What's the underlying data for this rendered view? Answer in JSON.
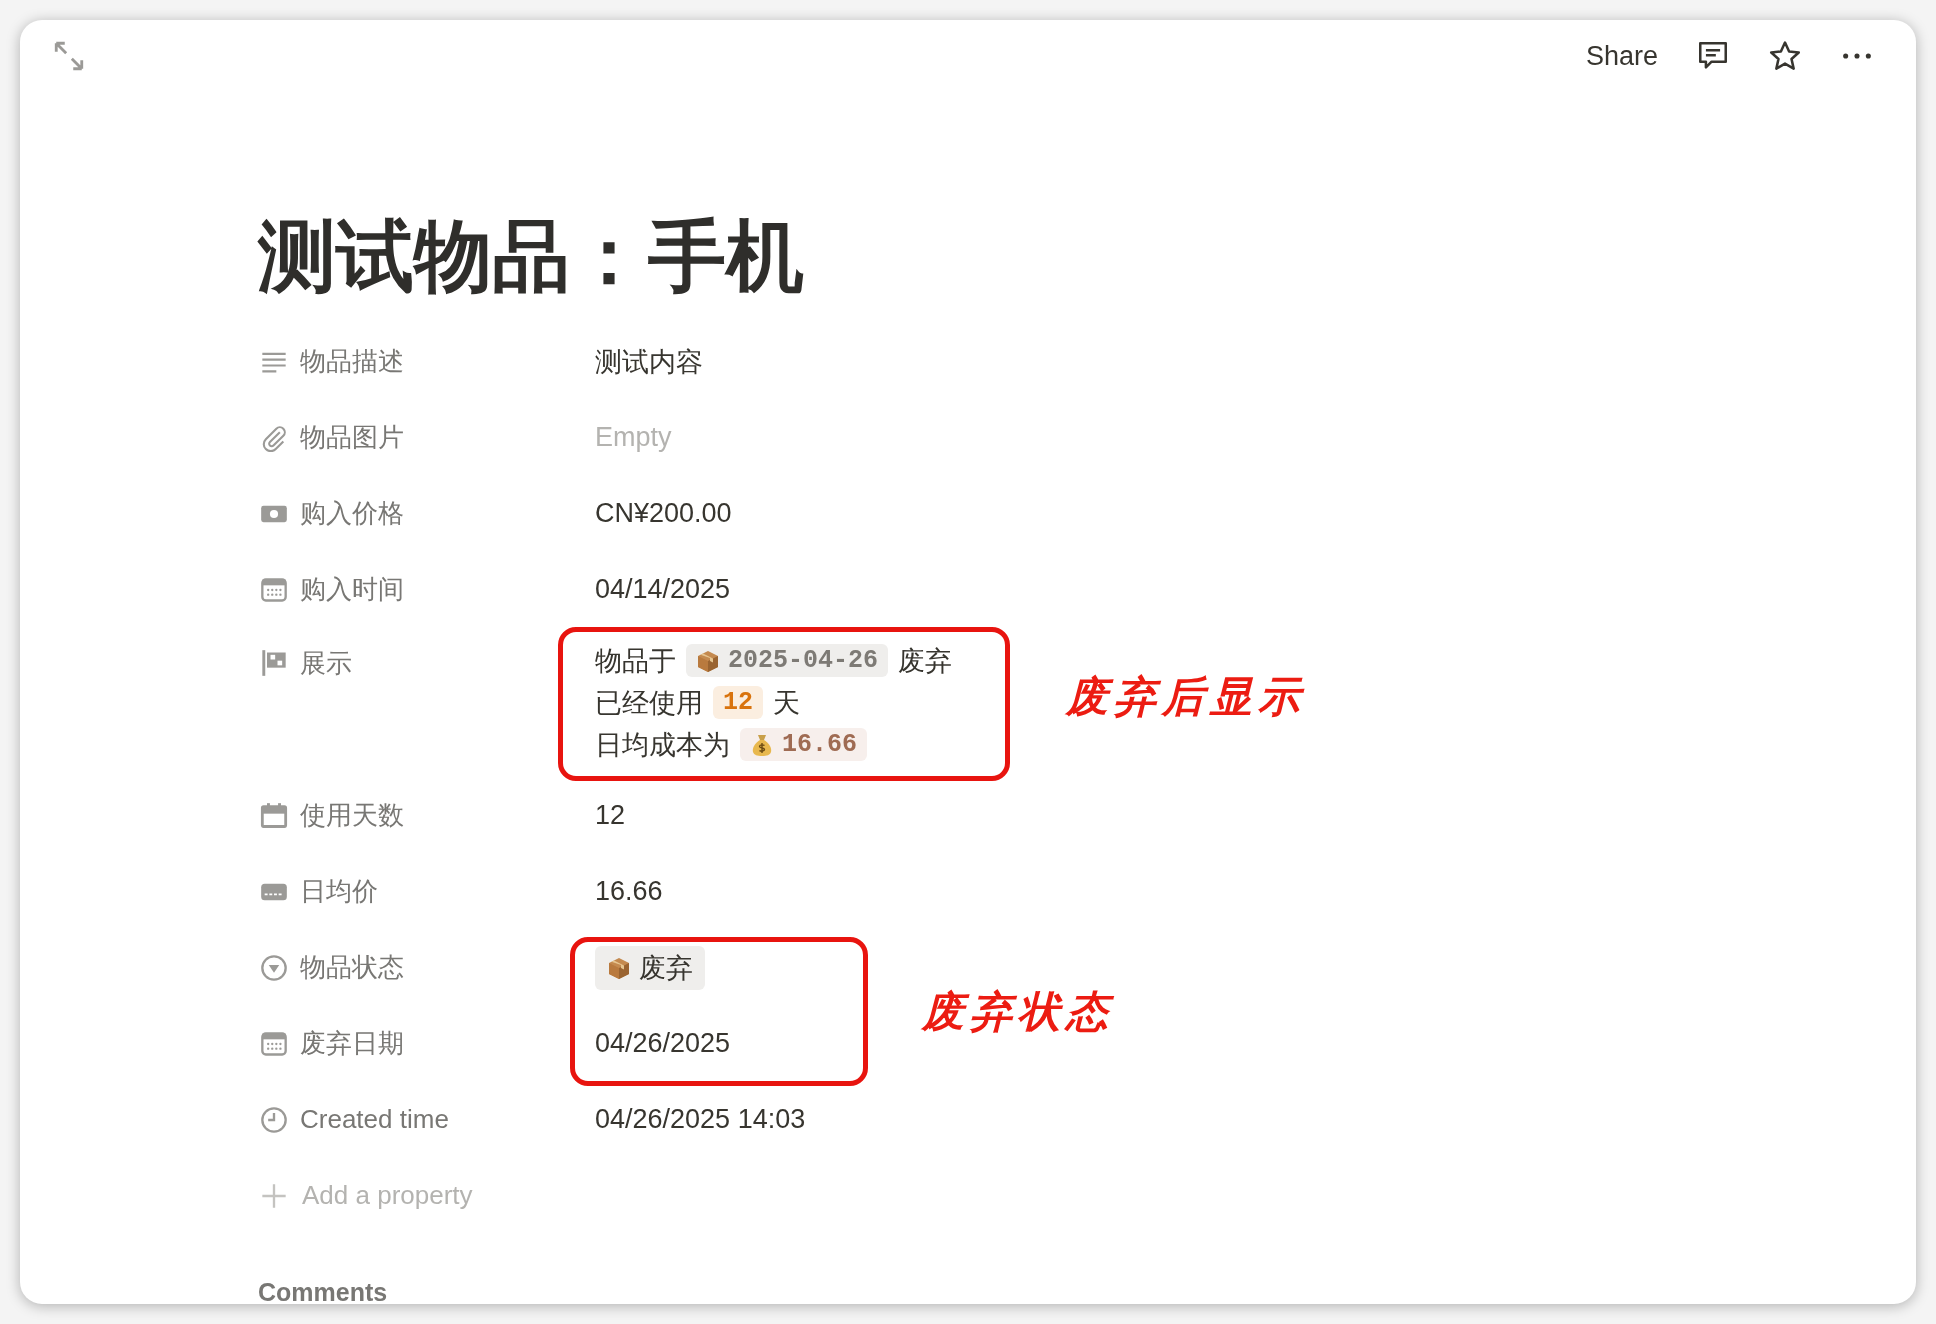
{
  "toolbar": {
    "share": "Share"
  },
  "title": "测试物品：手机",
  "properties": [
    {
      "kind": "text",
      "label": "物品描述",
      "value": "测试内容",
      "empty": false
    },
    {
      "kind": "files",
      "label": "物品图片",
      "value": "Empty",
      "empty": true
    },
    {
      "kind": "number",
      "label": "购入价格",
      "value": "CN¥200.00",
      "empty": false
    },
    {
      "kind": "date",
      "label": "购入时间",
      "value": "04/14/2025",
      "empty": false
    },
    {
      "kind": "formula",
      "label": "展示",
      "lines": [
        [
          {
            "kind": "text",
            "text": "物品于"
          },
          {
            "kind": "date_chip",
            "text": "2025-04-26"
          },
          {
            "kind": "text",
            "text": "废弃"
          }
        ],
        [
          {
            "kind": "text",
            "text": "已经使用"
          },
          {
            "kind": "count_chip",
            "text": "12"
          },
          {
            "kind": "text",
            "text": "天"
          }
        ],
        [
          {
            "kind": "text",
            "text": "日均成本为"
          },
          {
            "kind": "cost_chip",
            "text": "16.66"
          }
        ]
      ]
    },
    {
      "kind": "days",
      "label": "使用天数",
      "value": "12",
      "empty": false
    },
    {
      "kind": "price",
      "label": "日均价",
      "value": "16.66",
      "empty": false
    },
    {
      "kind": "status",
      "label": "物品状态",
      "tag": "废弃"
    },
    {
      "kind": "date",
      "label": "废弃日期",
      "value": "04/26/2025",
      "empty": false
    },
    {
      "kind": "created_time",
      "label": "Created time",
      "value": "04/26/2025 14:03",
      "empty": false
    }
  ],
  "add_property": "Add a property",
  "comments_heading": "Comments",
  "annotations": [
    {
      "text": "废弃后显示"
    },
    {
      "text": "废弃状态"
    }
  ]
}
